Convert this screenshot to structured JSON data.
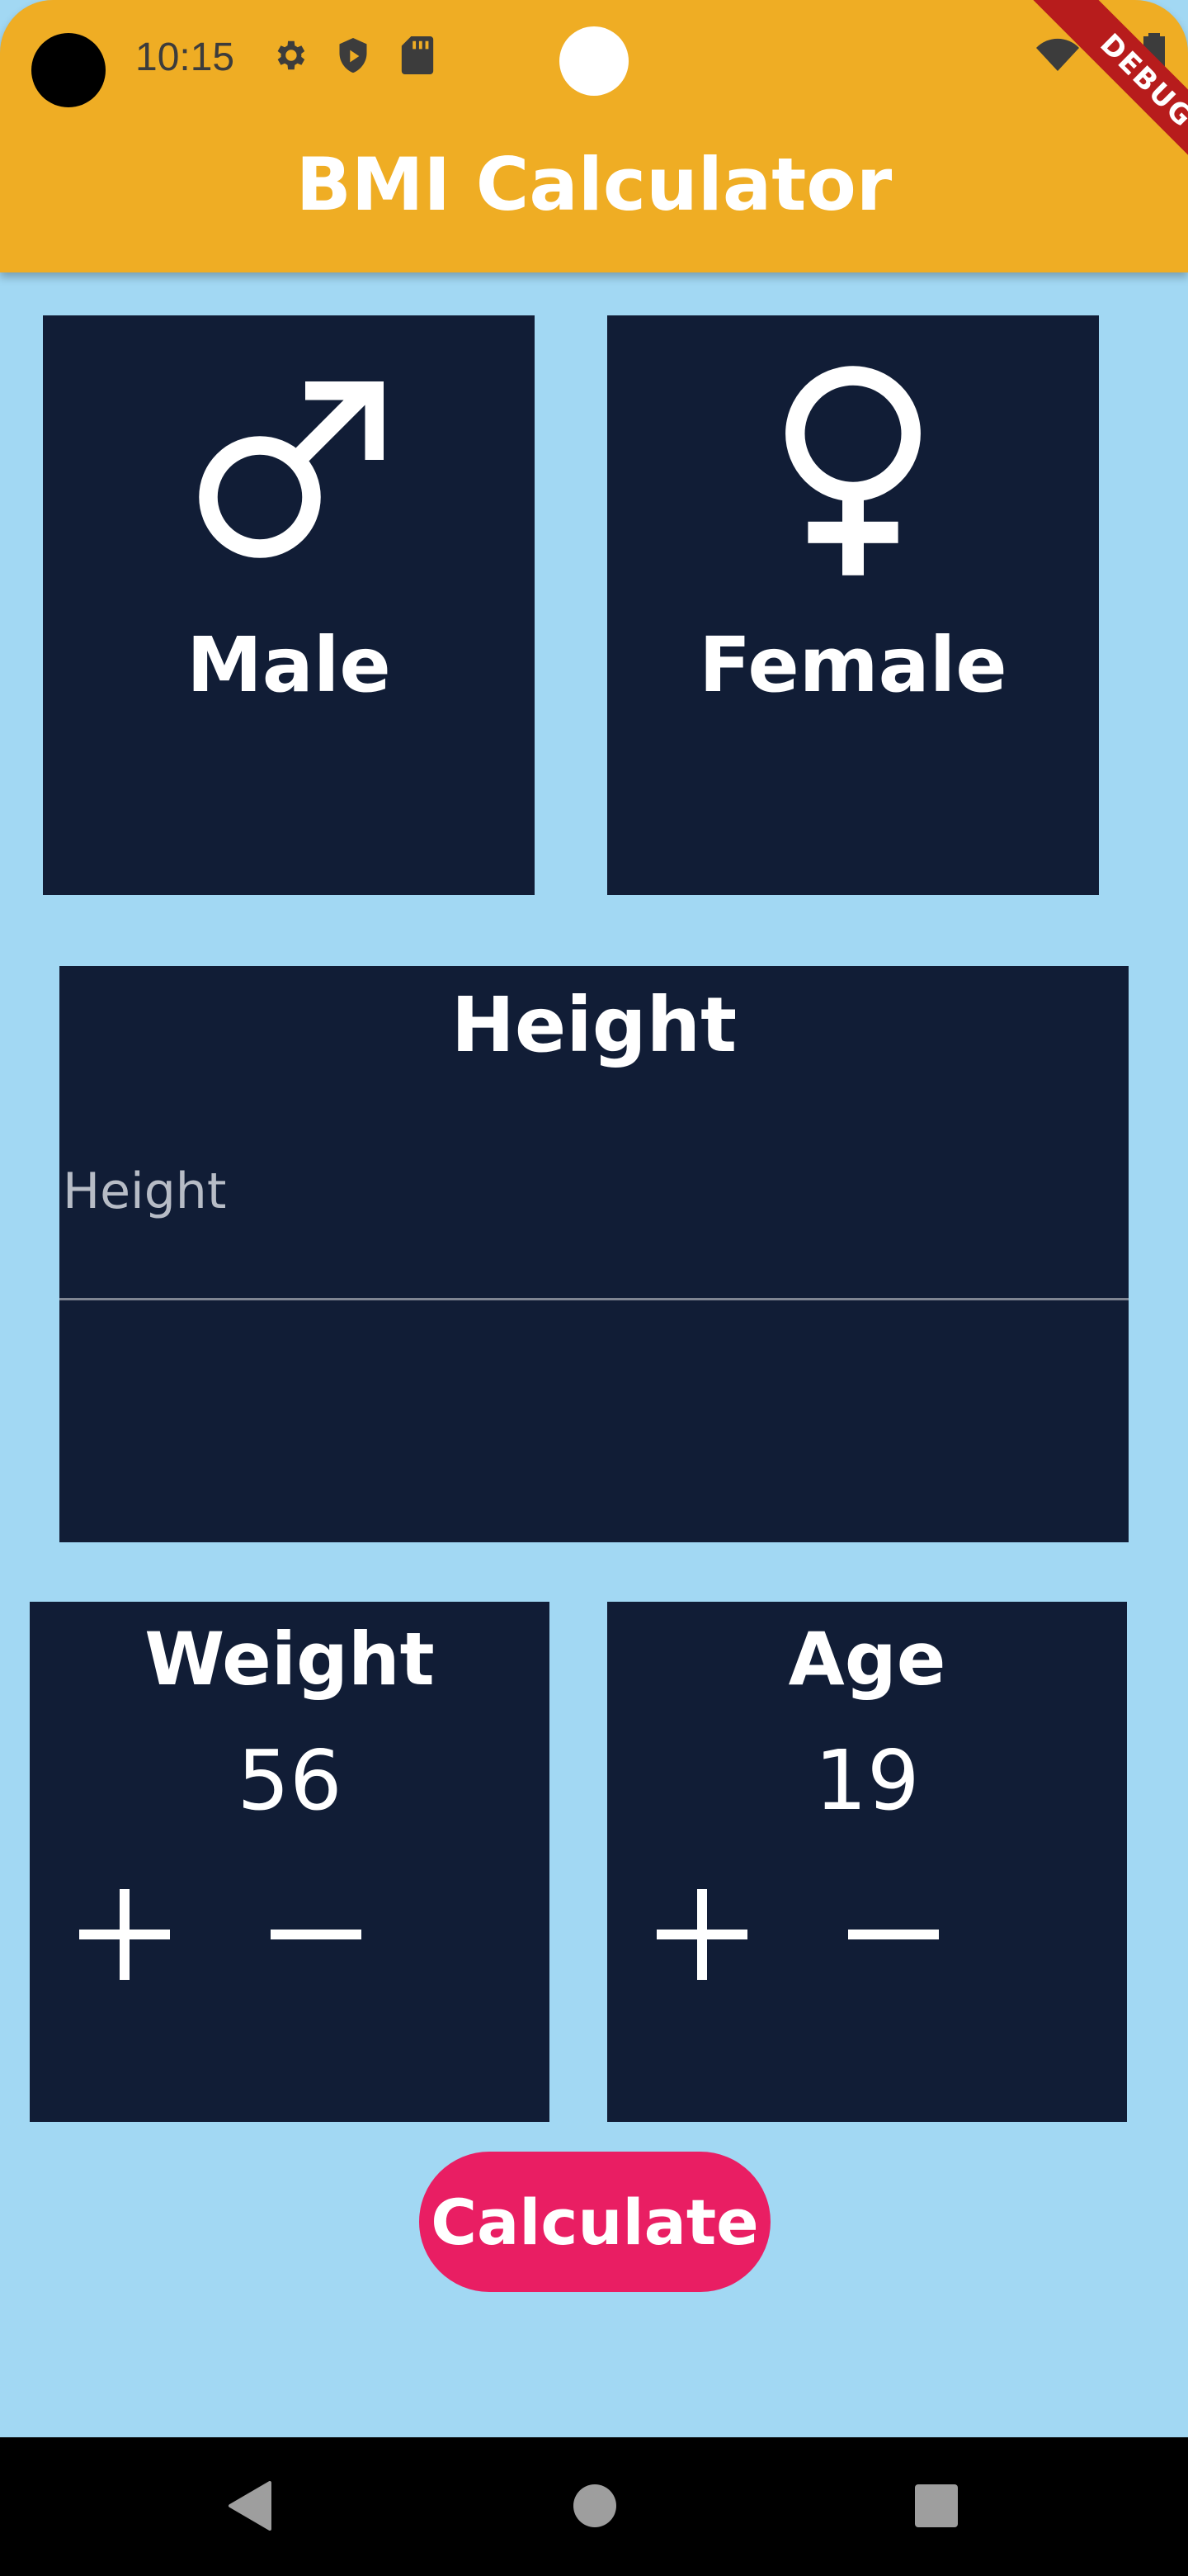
{
  "status_bar": {
    "time": "10:15",
    "icons": [
      "gear-icon",
      "shield-icon",
      "sd-card-icon",
      "wifi-icon",
      "battery-icon"
    ]
  },
  "app_bar": {
    "title": "BMI Calculator",
    "debug_badge": "DEBUG",
    "color": "#EFAD24"
  },
  "gender": {
    "male_label": "Male",
    "female_label": "Female",
    "card_color": "#111D36"
  },
  "height": {
    "title": "Height",
    "placeholder": "Height",
    "value": ""
  },
  "weight": {
    "title": "Weight",
    "value": "56"
  },
  "age": {
    "title": "Age",
    "value": "19"
  },
  "calculate": {
    "label": "Calculate",
    "color": "#E91E63"
  },
  "background_color": "#A2D8F3"
}
